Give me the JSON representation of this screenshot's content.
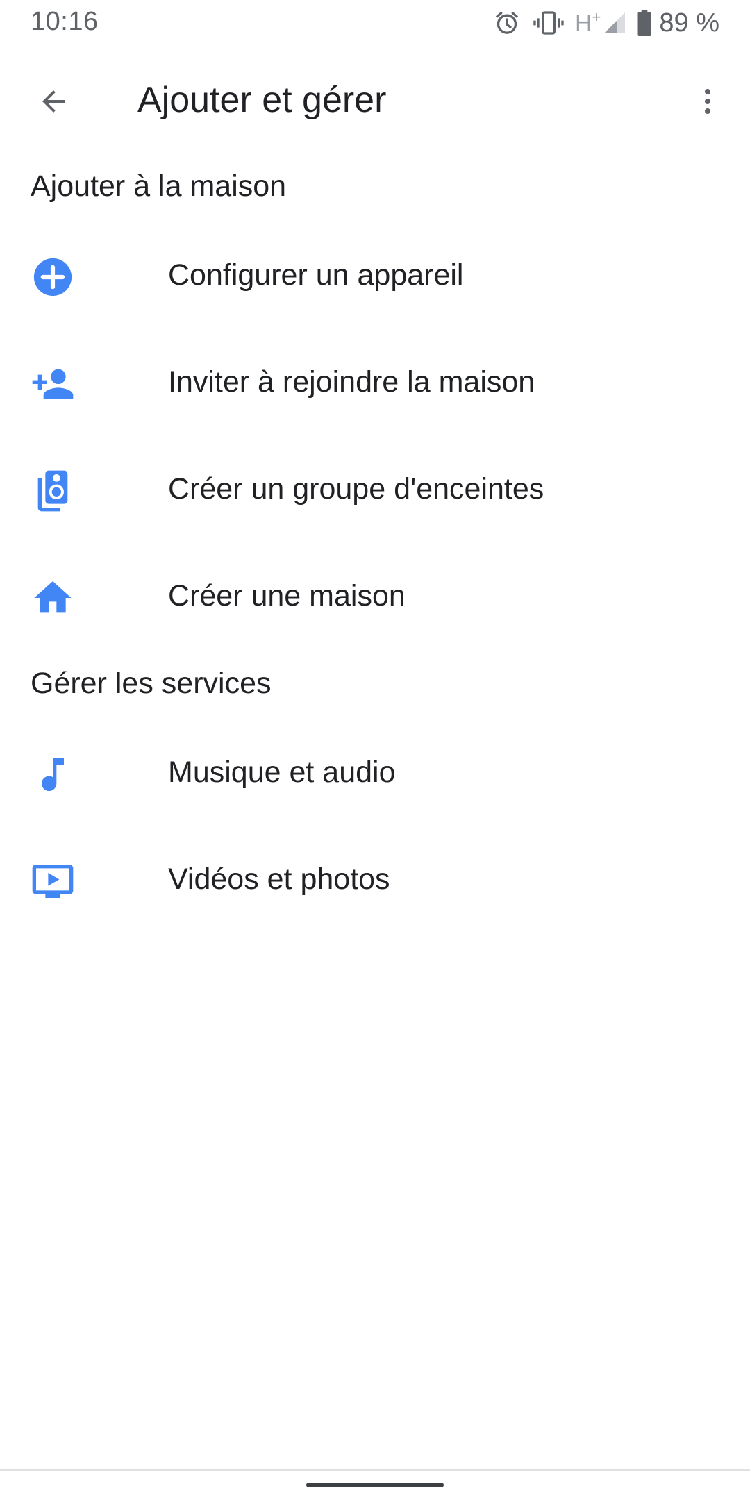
{
  "status_bar": {
    "time": "10:16",
    "icons": [
      "alarm-icon",
      "vibrate-icon",
      "signal-icon",
      "battery-icon"
    ],
    "network_label": "H",
    "network_plus": "+",
    "battery_percent": "89 %"
  },
  "toolbar": {
    "title": "Ajouter et gérer",
    "back_icon": "arrow-back-icon",
    "overflow_icon": "more-vert-icon"
  },
  "sections": [
    {
      "header": "Ajouter à la maison",
      "items": [
        {
          "label": "Configurer un appareil",
          "icon": "add-circle-icon"
        },
        {
          "label": "Inviter à rejoindre la maison",
          "icon": "person-add-icon"
        },
        {
          "label": "Créer un groupe d'enceintes",
          "icon": "speaker-group-icon"
        },
        {
          "label": "Créer une maison",
          "icon": "home-icon"
        }
      ]
    },
    {
      "header": "Gérer les services",
      "items": [
        {
          "label": "Musique et audio",
          "icon": "music-note-icon"
        },
        {
          "label": "Vidéos et photos",
          "icon": "video-play-icon"
        }
      ]
    }
  ],
  "colors": {
    "accent": "#4285f4",
    "text_primary": "#202124",
    "icon_gray": "#5f6368"
  }
}
